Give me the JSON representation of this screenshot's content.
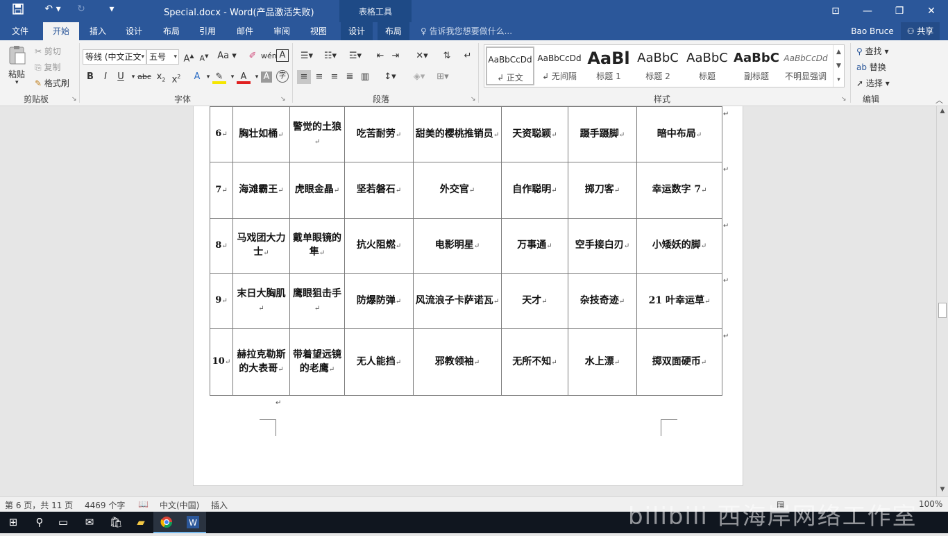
{
  "titlebar": {
    "title": "Special.docx - Word(产品激活失败)",
    "context_title": "表格工具",
    "user": "Bao Bruce",
    "share": "共享"
  },
  "tabs": [
    "文件",
    "开始",
    "插入",
    "设计",
    "布局",
    "引用",
    "邮件",
    "审阅",
    "视图",
    "设计",
    "布局"
  ],
  "tell_me": "告诉我您想要做什么...",
  "clipboard": {
    "paste": "粘贴",
    "cut": "剪切",
    "copy": "复制",
    "format_painter": "格式刷",
    "group": "剪贴板"
  },
  "font": {
    "name": "等线 (中文正文",
    "size": "五号",
    "group": "字体"
  },
  "paragraph": {
    "group": "段落"
  },
  "styles": {
    "group": "样式",
    "items": [
      {
        "sample": "AaBbCcDd",
        "name": "↲ 正文"
      },
      {
        "sample": "AaBbCcDd",
        "name": "↲ 无间隔"
      },
      {
        "sample": "AaBl",
        "name": "标题 1"
      },
      {
        "sample": "AaBbC",
        "name": "标题 2"
      },
      {
        "sample": "AaBbC",
        "name": "标题"
      },
      {
        "sample": "AaBbC",
        "name": "副标题"
      },
      {
        "sample": "AaBbCcDd",
        "name": "不明显强调"
      }
    ]
  },
  "editing": {
    "find": "查找",
    "replace": "替换",
    "select": "选择",
    "group": "编辑"
  },
  "table": {
    "rows": [
      {
        "num": "6",
        "cells": [
          "胸壮如桶",
          "警觉的土狼",
          "吃苦耐劳",
          "甜美的樱桃推销员",
          "天资聪颖",
          "蹑手蹑脚",
          "暗中布局"
        ]
      },
      {
        "num": "7",
        "cells": [
          "海滩霸王",
          "虎眼金晶",
          "坚若磐石",
          "外交官",
          "自作聪明",
          "掷刀客",
          "幸运数字 7"
        ]
      },
      {
        "num": "8",
        "cells": [
          "马戏团大力士",
          "戴单眼镜的隼",
          "抗火阻燃",
          "电影明星",
          "万事通",
          "空手接白刃",
          "小矮妖的脚"
        ]
      },
      {
        "num": "9",
        "cells": [
          "末日大胸肌",
          "鹰眼狙击手",
          "防爆防弹",
          "风流浪子卡萨诺瓦",
          "天才",
          "杂技奇迹",
          "21 叶幸运草"
        ]
      },
      {
        "num": "10",
        "cells": [
          "赫拉克勒斯的大表哥",
          "带着望远镜的老鹰",
          "无人能挡",
          "邪教领袖",
          "无所不知",
          "水上漂",
          "掷双面硬币"
        ]
      }
    ]
  },
  "status": {
    "page": "第 6 页，共 11 页",
    "words": "4469 个字",
    "language": "中文(中国)",
    "mode": "插入",
    "zoom": "100%"
  },
  "watermark": "bilibili 西海岸网络工作室"
}
